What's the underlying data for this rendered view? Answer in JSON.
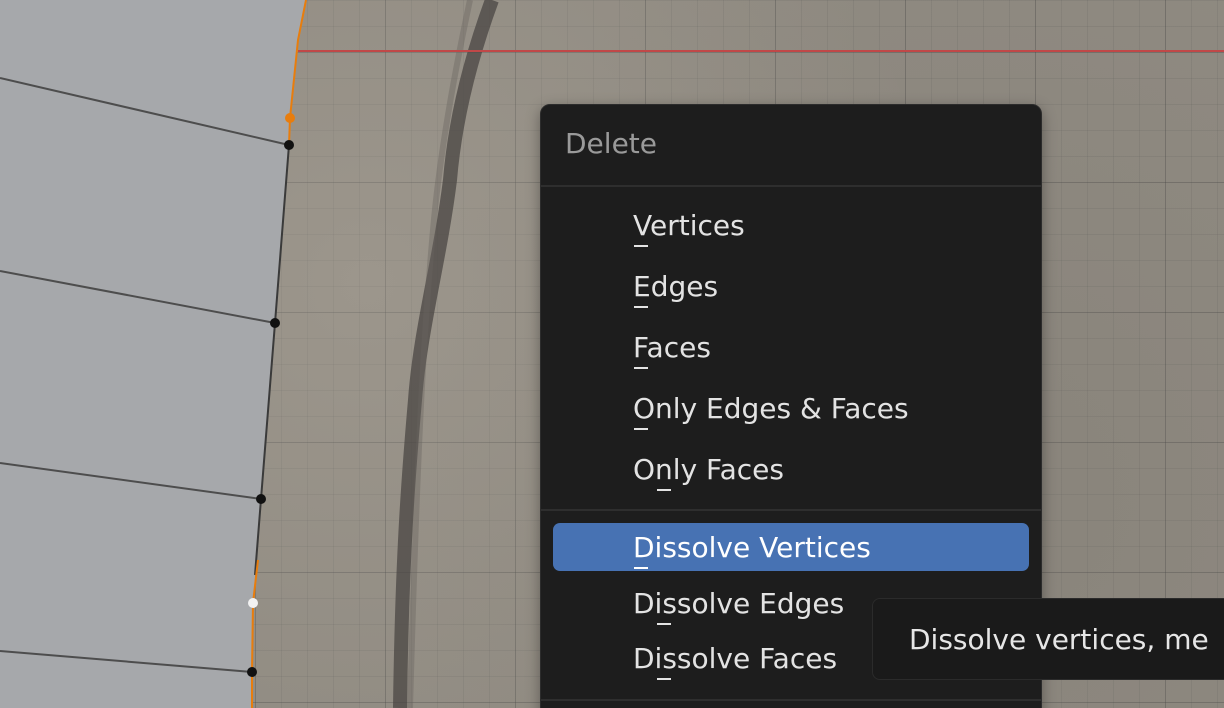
{
  "menu": {
    "title": "Delete",
    "items": [
      {
        "label": "Vertices",
        "hotkey": "V"
      },
      {
        "label": "Edges",
        "hotkey": "E"
      },
      {
        "label": "Faces",
        "hotkey": "F"
      },
      {
        "label": "Only Edges & Faces",
        "hotkey": "O"
      },
      {
        "label": "Only Faces",
        "hotkey": "n"
      },
      {
        "label": "Dissolve Vertices",
        "hotkey": "D",
        "highlighted": true
      },
      {
        "label": "Dissolve Edges",
        "hotkey": "s"
      },
      {
        "label": "Dissolve Faces",
        "hotkey": "s"
      }
    ]
  },
  "tooltip": {
    "text": "Dissolve vertices, me"
  },
  "colors": {
    "highlight": "#4772b3",
    "menu_background": "#1d1d1d",
    "selected_edge": "#e87d0d",
    "axis_line": "#c04848",
    "mesh_face": "#a6a8ab"
  }
}
